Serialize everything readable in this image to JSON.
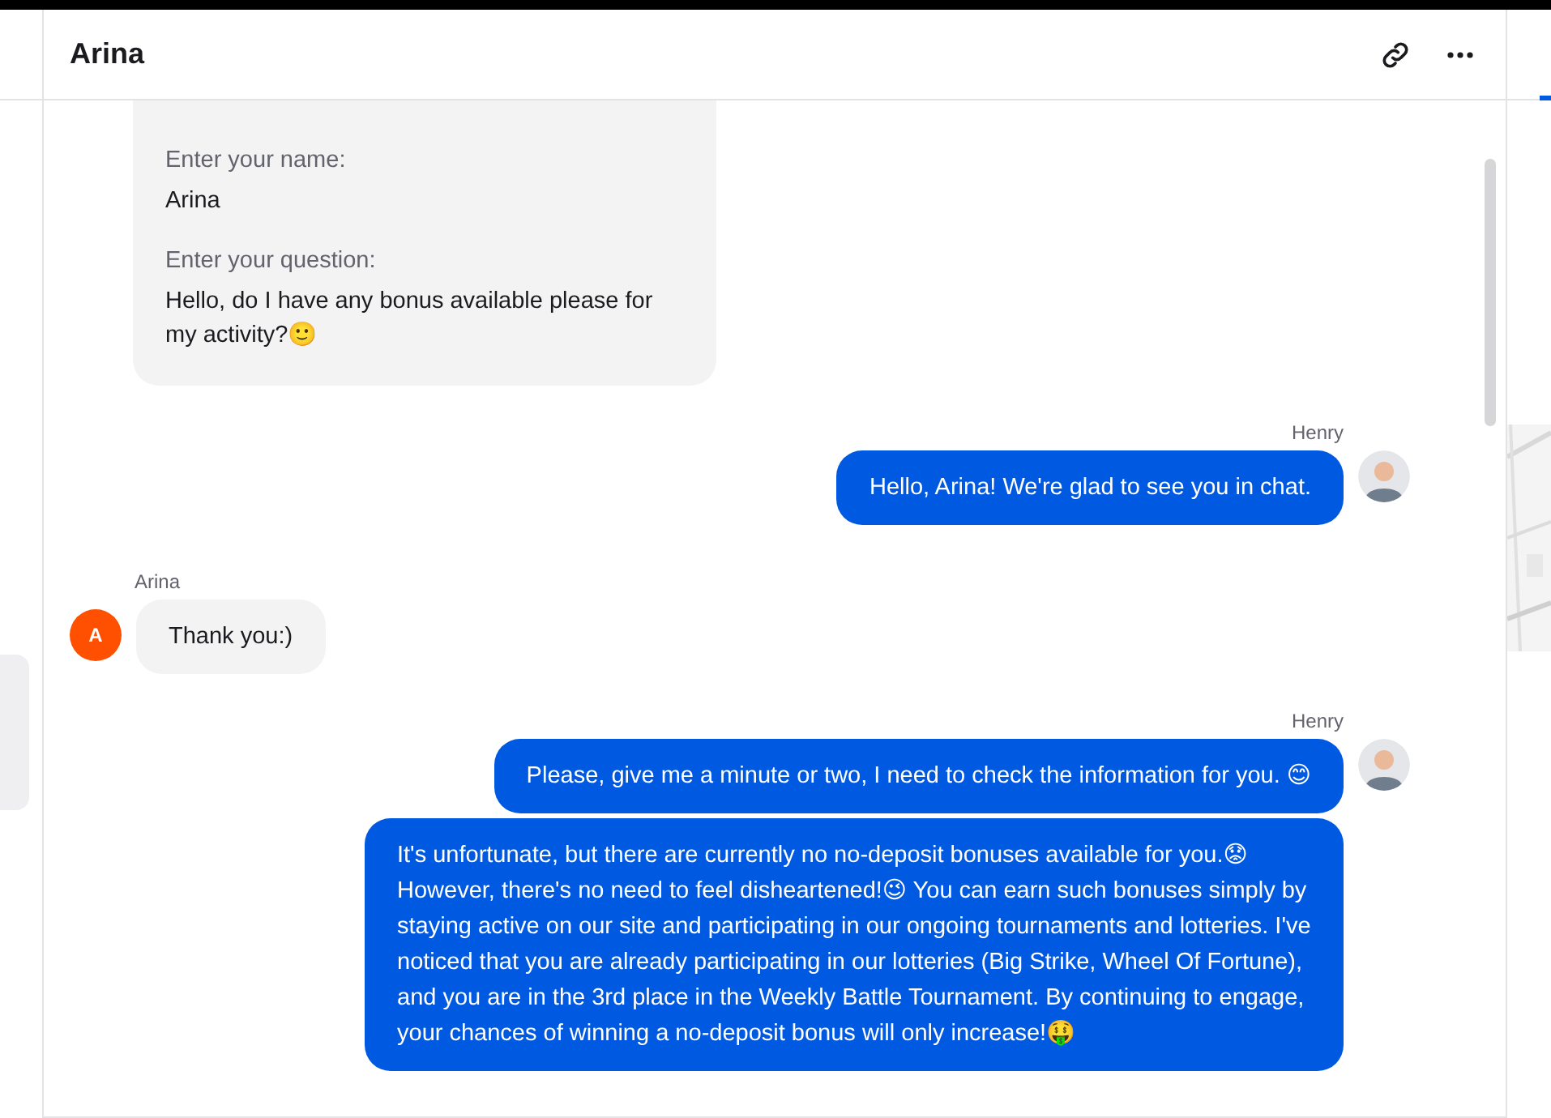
{
  "header": {
    "title": "Arina"
  },
  "form": {
    "fields": [
      {
        "label": "Enter your name:",
        "value": "Arina"
      },
      {
        "label": "Enter your question:",
        "value": "Hello, do I have any bonus available please for my activity?🙂"
      }
    ]
  },
  "messages": [
    {
      "kind": "agent",
      "sender": "Henry",
      "bubbles": [
        "Hello, Arina! We're glad to see you in chat."
      ]
    },
    {
      "kind": "visitor",
      "sender": "Arina",
      "initial": "A",
      "bubbles": [
        "Thank you:)"
      ]
    },
    {
      "kind": "agent",
      "sender": "Henry",
      "bubbles": [
        "Please, give me a minute or two, I need to check the information for you. 😊",
        "It's unfortunate, but there are currently no no-deposit bonuses available for you.😟 However, there's no need to feel disheartened!😉 You can earn such bonuses simply by staying active on our site and participating in our ongoing tournaments and lotteries. I've noticed that you are already participating in our lotteries (Big Strike, Wheel Of Fortune), and you are in the 3rd place in the Weekly Battle Tournament. By continuing to engage, your chances of winning a no-deposit bonus will only increase!🤑"
      ]
    }
  ]
}
